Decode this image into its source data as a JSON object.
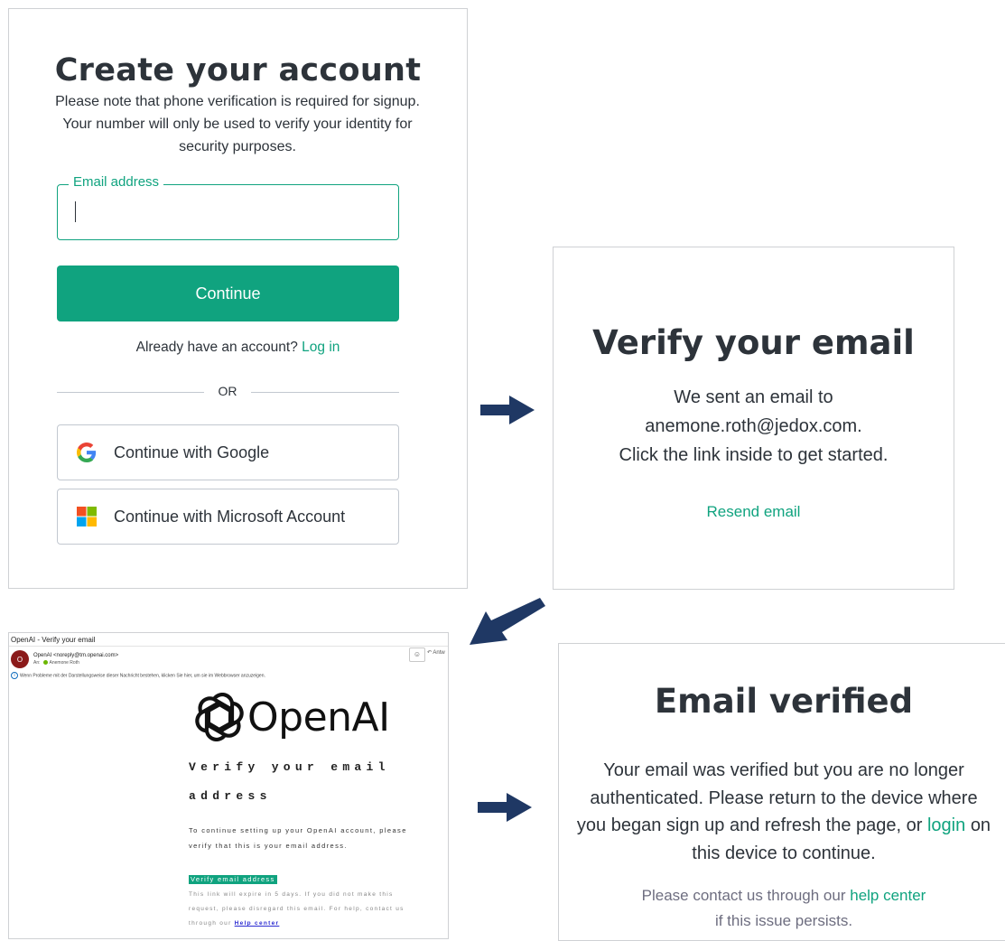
{
  "signup": {
    "title": "Create your account",
    "note": "Please note that phone verification is required for signup. Your number will only be used to verify your identity for security purposes.",
    "email_label": "Email address",
    "email_value": "",
    "continue_label": "Continue",
    "already_text": "Already have an account?",
    "login_link": "Log in",
    "or_text": "OR",
    "google_label": "Continue with Google",
    "microsoft_label": "Continue with Microsoft Account"
  },
  "verify": {
    "title": "Verify your email",
    "line1": "We sent an email to",
    "email": "anemone.roth@jedox.com.",
    "line3": "Click the link inside to get started.",
    "resend_label": "Resend email"
  },
  "mail": {
    "subject": "OpenAI - Verify your email",
    "avatar_initial": "O",
    "from": "OpenAI <noreply@tm.openai.com>",
    "to_prefix": "An:",
    "to_name": "Anemone Roth",
    "info_text": "Wenn Probleme mit der Darstellungsweise dieser Nachricht bestehen, klicken Sie hier, um sie im Webbrowser anzuzeigen.",
    "reply_label": "Antw",
    "logo_word": "OpenAI",
    "heading_line1": "Verify your email",
    "heading_line2": "address",
    "body": "To continue setting up your OpenAI account, please verify that this is your email address.",
    "button_label": "Verify email address",
    "fine_print": "This link will expire in 5 days. If you did not make this request, please disregard this email. For help, contact us through our",
    "help_link": "Help center"
  },
  "verified": {
    "title": "Email verified",
    "msg_before": "Your email was verified but you are no longer authenticated. Please return to the device where you began sign up and refresh the page, or",
    "login_link": "login",
    "msg_after": "on this device to continue.",
    "contact_before": "Please contact us through our",
    "help_link": "help center",
    "contact_after": "if this issue persists."
  },
  "colors": {
    "accent": "#10a37f",
    "arrow": "#1f3864",
    "text": "#2d333a"
  }
}
